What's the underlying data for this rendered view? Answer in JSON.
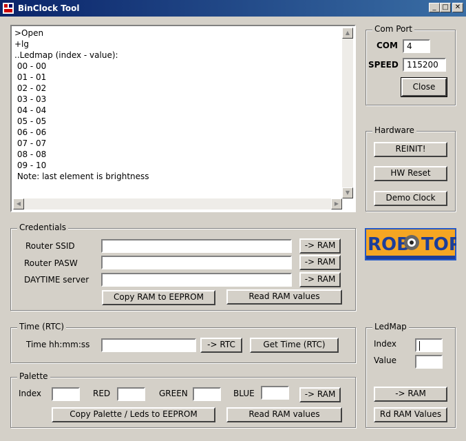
{
  "window": {
    "title": "BinClock Tool"
  },
  "log": {
    "lines": ">Open\n+lg\n..Ledmap (index - value):\n 00 - 00\n 01 - 01\n 02 - 02\n 03 - 03\n 04 - 04\n 05 - 05\n 06 - 06\n 07 - 07\n 08 - 08\n 09 - 10\n Note: last element is brightness"
  },
  "com_port": {
    "group_label": "Com Port",
    "com_label": "COM",
    "com_value": "4",
    "speed_label": "SPEED",
    "speed_value": "115200",
    "close_button": "Close"
  },
  "hardware": {
    "group_label": "Hardware",
    "reinit_button": "REINIT!",
    "hw_reset_button": "HW Reset",
    "demo_clock_button": "Demo Clock"
  },
  "logo": {
    "text_left": "ROB",
    "text_right": "TOP"
  },
  "credentials": {
    "group_label": "Credentials",
    "ssid_label": "Router SSID",
    "ssid_value": "",
    "pasw_label": "Router PASW",
    "pasw_value": "",
    "daytime_label": "DAYTIME server",
    "daytime_value": "",
    "to_ram_button": "-> RAM",
    "copy_eeprom_button": "Copy RAM to EEPROM",
    "read_ram_button": "Read RAM values"
  },
  "time": {
    "group_label": "Time (RTC)",
    "time_label": "Time hh:mm:ss",
    "time_value": "",
    "to_rtc_button": "-> RTC",
    "get_time_button": "Get Time (RTC)"
  },
  "palette": {
    "group_label": "Palette",
    "index_label": "Index",
    "red_label": "RED",
    "green_label": "GREEN",
    "blue_label": "BLUE",
    "to_ram_button": "-> RAM",
    "copy_button": "Copy Palette / Leds to EEPROM",
    "read_ram_button": "Read RAM values"
  },
  "ledmap": {
    "group_label": "LedMap",
    "index_label": "Index",
    "value_label": "Value",
    "to_ram_button": "-> RAM",
    "rd_ram_button": "Rd RAM Values"
  },
  "colors": {
    "titlebar_start": "#0a246a",
    "logo_orange": "#f5a623",
    "logo_blue": "#2458c8"
  }
}
